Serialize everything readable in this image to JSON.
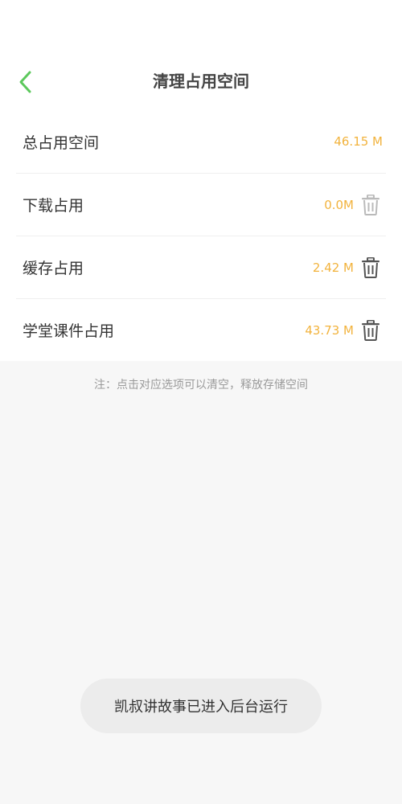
{
  "header": {
    "title": "清理占用空间",
    "back_icon": "chevron-left-icon",
    "accent_color": "#5cc85c"
  },
  "rows": [
    {
      "label": "总占用空间",
      "value": "46.15 M",
      "deletable": false
    },
    {
      "label": "下载占用",
      "value": "0.0M",
      "deletable": true,
      "enabled": false
    },
    {
      "label": "缓存占用",
      "value": "2.42 M",
      "deletable": true,
      "enabled": true
    },
    {
      "label": "学堂课件占用",
      "value": "43.73 M",
      "deletable": true,
      "enabled": true
    }
  ],
  "note": "注：点击对应选项可以清空，释放存储空间",
  "toast": "凯叔讲故事已进入后台运行",
  "colors": {
    "value": "#f2b33d",
    "label": "#333333",
    "note": "#9a9a9a"
  }
}
